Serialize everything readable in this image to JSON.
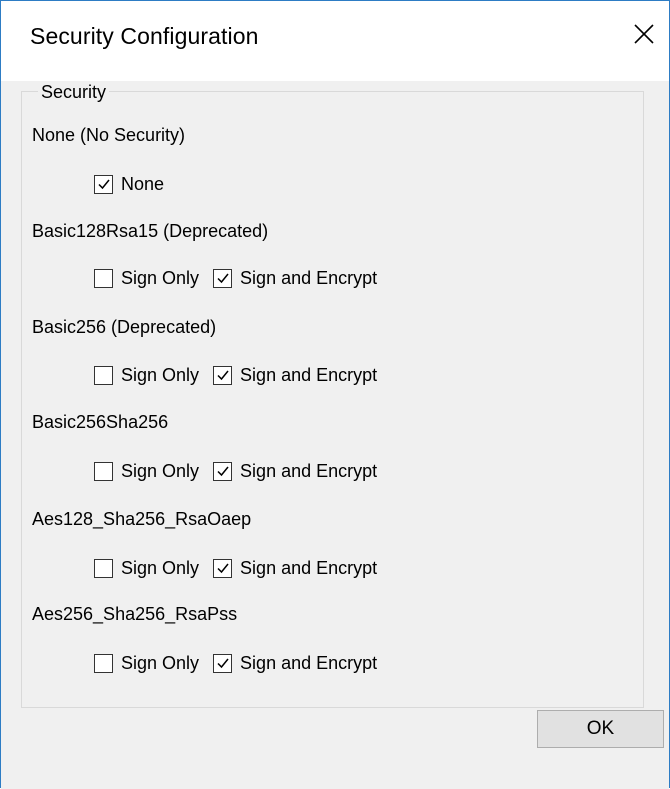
{
  "window": {
    "title": "Security Configuration",
    "close_icon": "close-icon"
  },
  "group": {
    "legend": "Security"
  },
  "policies": [
    {
      "label": "None (No Security)",
      "options": [
        {
          "label": "None",
          "checked": true
        }
      ]
    },
    {
      "label": "Basic128Rsa15 (Deprecated)",
      "options": [
        {
          "label": "Sign Only",
          "checked": false
        },
        {
          "label": "Sign and Encrypt",
          "checked": true
        }
      ]
    },
    {
      "label": "Basic256 (Deprecated)",
      "options": [
        {
          "label": "Sign Only",
          "checked": false
        },
        {
          "label": "Sign and Encrypt",
          "checked": true
        }
      ]
    },
    {
      "label": "Basic256Sha256",
      "options": [
        {
          "label": "Sign Only",
          "checked": false
        },
        {
          "label": "Sign and Encrypt",
          "checked": true
        }
      ]
    },
    {
      "label": "Aes128_Sha256_RsaOaep",
      "options": [
        {
          "label": "Sign Only",
          "checked": false
        },
        {
          "label": "Sign and Encrypt",
          "checked": true
        }
      ]
    },
    {
      "label": "Aes256_Sha256_RsaPss",
      "options": [
        {
          "label": "Sign Only",
          "checked": false
        },
        {
          "label": "Sign and Encrypt",
          "checked": true
        }
      ]
    }
  ],
  "buttons": {
    "ok_label": "OK"
  },
  "colors": {
    "window_border": "#2d7cc4",
    "client_background": "#f0f0f0",
    "button_face": "#e1e1e1"
  }
}
